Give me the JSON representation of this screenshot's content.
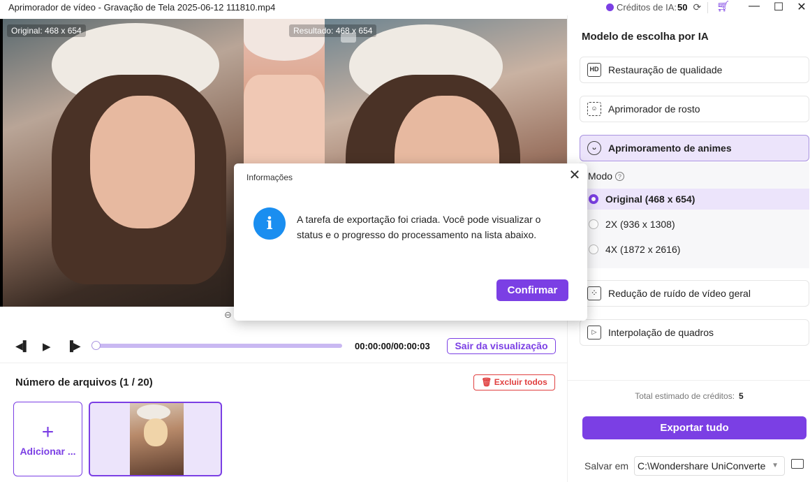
{
  "window": {
    "title": "Aprimorador de vídeo - Gravação de Tela 2025-06-12 111810.mp4",
    "credits_label": "Créditos de IA:",
    "credits_value": "50"
  },
  "preview": {
    "original_tag": "Original: 468 x 654",
    "result_tag": "Resultado: 468 x 654"
  },
  "player": {
    "time": "00:00:00/00:00:03",
    "exit_label": "Sair da visualização",
    "progress": 0
  },
  "files": {
    "title": "Número de arquivos (1 / 20)",
    "delete_all": "Excluir todos",
    "add_label": "Adicionar ..."
  },
  "panel": {
    "title": "Modelo de escolha por IA",
    "options": [
      {
        "label": "Restauração de qualidade",
        "icon": "hd-icon"
      },
      {
        "label": "Aprimorador de rosto",
        "icon": "face-scan-icon"
      },
      {
        "label": "Aprimoramento de animes",
        "icon": "anime-icon",
        "selected": true
      },
      {
        "label": "Redução de ruído de vídeo geral",
        "icon": "denoise-icon"
      },
      {
        "label": "Interpolação de quadros",
        "icon": "frame-interpolation-icon"
      }
    ],
    "mode_label": "Modo",
    "modes": [
      {
        "label": "Original (468 x 654)",
        "selected": true
      },
      {
        "label": "2X (936 x 1308)",
        "selected": false
      },
      {
        "label": "4X (1872 x 2616)",
        "selected": false
      }
    ],
    "estimate_label": "Total estimado de créditos:",
    "estimate_value": "5",
    "export_label": "Exportar tudo",
    "save_label": "Salvar em",
    "save_path": "C:\\Wondershare UniConverte"
  },
  "dialog": {
    "title": "Informações",
    "message": "A tarefa de exportação foi criada. Você pode visualizar o status e o progresso do processamento na lista abaixo.",
    "confirm": "Confirmar"
  },
  "colors": {
    "accent": "#7b3fe4",
    "accent_light": "#ece4fb",
    "danger": "#e04040",
    "info": "#1a8ef0"
  }
}
